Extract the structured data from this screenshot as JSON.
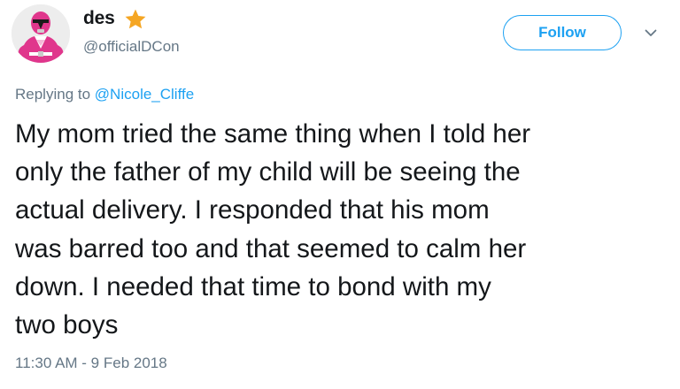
{
  "author": {
    "display_name": "des",
    "handle": "@officialDCon",
    "avatar_icon": "pink-ranger-avatar",
    "badge_icon": "star-icon",
    "badge_color": "#f5a623"
  },
  "actions": {
    "follow_label": "Follow",
    "menu_icon": "chevron-down-icon",
    "accent_color": "#1da1f2"
  },
  "reply": {
    "prefix": "Replying to",
    "mention": "@Nicole_Cliffe"
  },
  "tweet": {
    "lines": [
      "My mom tried the same thing when I told her",
      "only the father of my child will be seeing the",
      "actual delivery. I responded that his mom",
      "was barred too and that seemed to calm her",
      "down. I needed that time to bond with my",
      "two boys"
    ],
    "timestamp": "11:30 AM - 9 Feb 2018"
  }
}
